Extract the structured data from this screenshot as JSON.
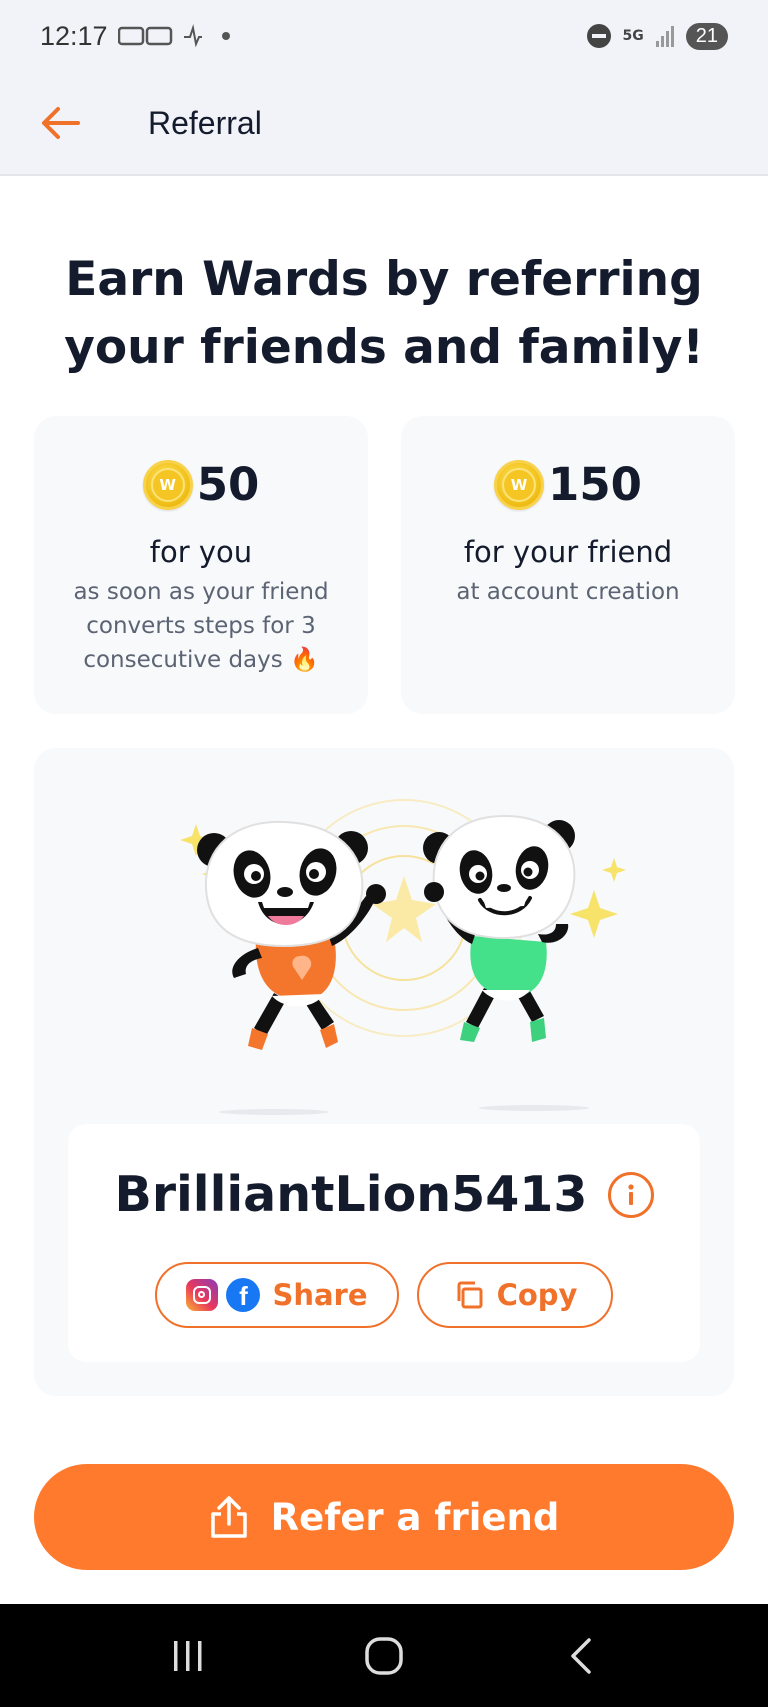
{
  "status_bar": {
    "time": "12:17",
    "network": "5G",
    "battery": "21"
  },
  "app_bar": {
    "title": "Referral",
    "back_icon": "arrow-left-icon"
  },
  "headline": "Earn Wards by referring your friends and family!",
  "rewards": [
    {
      "amount": "50",
      "coin_letter": "W",
      "for": "for you",
      "description": "as soon as your friend converts steps for 3 consecutive days 🔥"
    },
    {
      "amount": "150",
      "coin_letter": "W",
      "for": "for your friend",
      "description": "at account creation"
    }
  ],
  "referral": {
    "code": "BrilliantLion5413",
    "share_label": "Share",
    "copy_label": "Copy"
  },
  "cta": {
    "label": "Refer a friend",
    "icon": "share-upload-icon"
  },
  "colors": {
    "accent": "#ff7a2c",
    "outline": "#f0712a",
    "text_dark": "#141b2d",
    "card_bg": "#f8f9fb",
    "coin": "#f5c623"
  }
}
